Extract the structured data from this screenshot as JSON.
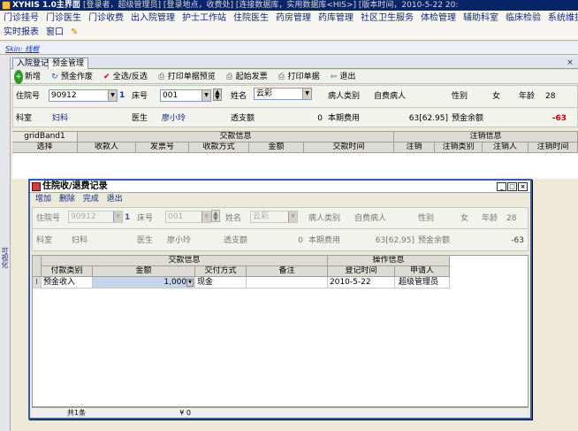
{
  "app": {
    "title": "XYHIS 1.0主界面",
    "info": "[登录者，超级管理员] [登录地点，收费处] [连接数据库，实用数据库<HIS>] [版本时间，2010-5-22 20:"
  },
  "menu": {
    "row1": [
      "门诊挂号",
      "门诊医生",
      "门诊收费",
      "出入院管理",
      "护士工作站",
      "住院医生",
      "药房管理",
      "药库管理",
      "社区卫生服务",
      "体检管理",
      "辅助科室",
      "临床检验",
      "系统维护"
    ],
    "row2": [
      "实时报表",
      "窗口"
    ]
  },
  "skin_label": "Skin: 线框",
  "side_label": "可视化",
  "tabs": [
    "入院登记",
    "预金管理"
  ],
  "tab_close": "×",
  "toolbar": [
    {
      "icon": "+",
      "label": "新增"
    },
    {
      "icon": "↻",
      "label": "预金作废"
    },
    {
      "icon": "✔",
      "label": "全选/反选"
    },
    {
      "icon": "⎙",
      "label": "打印单据预览"
    },
    {
      "icon": "⎙",
      "label": "起始发票"
    },
    {
      "icon": "⎙",
      "label": "打印单据"
    },
    {
      "icon": "⇦",
      "label": "退出"
    }
  ],
  "main_form": {
    "row1": {
      "inpatient_no_label": "住院号",
      "inpatient_no": "90912",
      "inpatient_no_suffix": "1",
      "bed_label": "床号",
      "bed_no": "001",
      "bed_suffix": "1",
      "name_label": "姓名",
      "name": "云彩",
      "patient_type_label": "病人类别",
      "patient_type": "自费病人",
      "sex_label": "性别",
      "sex": "女",
      "age_label": "年龄",
      "age": "28"
    },
    "row2": {
      "dept_label": "科室",
      "dept": "妇科",
      "doctor_label": "医生",
      "doctor": "廖小玲",
      "overdraft_label": "透支额",
      "overdraft": "0",
      "period_label": "本期费用",
      "period": "63[62.95]",
      "balance_label": "预金余额",
      "balance": "-63"
    }
  },
  "main_grid": {
    "band_left": "gridBand1",
    "band_mid": "交款信息",
    "band_right": "注销信息",
    "headers": [
      "选择",
      "收款人",
      "发票号",
      "收款方式",
      "金额",
      "交款时间",
      "注销",
      "注销类别",
      "注销人",
      "注销时间"
    ]
  },
  "dialog": {
    "title": "住院收/退费记录",
    "menu": [
      "增加",
      "删除",
      "完成",
      "退出"
    ],
    "win_buttons": [
      "_",
      "□",
      "×"
    ],
    "form": {
      "row1": {
        "inpatient_no_label": "住院号",
        "inpatient_no": "90912",
        "inpatient_no_suffix": "1",
        "bed_label": "床号",
        "bed_no": "001",
        "name_label": "姓名",
        "name": "云彩",
        "patient_type_label": "病人类别",
        "patient_type": "自费病人",
        "sex_label": "性别",
        "sex": "女",
        "age_label": "年龄",
        "age": "28"
      },
      "row2": {
        "dept_label": "科室",
        "dept": "妇科",
        "doctor_label": "医生",
        "doctor": "廖小玲",
        "overdraft_label": "透支额",
        "overdraft": "0",
        "period_label": "本期费用",
        "period": "63[62.95]",
        "balance_label": "预金余额",
        "balance": "-63"
      }
    },
    "grid": {
      "band_left": "交款信息",
      "band_right": "操作信息",
      "headers": [
        "付款类别",
        "金额",
        "交付方式",
        "备注",
        "登记时间",
        "申请人"
      ],
      "rows": [
        {
          "indicator": "I",
          "type": "预金收入",
          "amount": "1,000.",
          "method": "现金",
          "note": "",
          "time": "2010-5-22",
          "applicant": "超级管理员"
        }
      ]
    },
    "footer": {
      "count": "共1条",
      "sum": "¥ 0"
    }
  },
  "colors": {
    "title_bar": "#0a246a",
    "menu_text": "#0e2880",
    "negative": "#cc0000"
  }
}
